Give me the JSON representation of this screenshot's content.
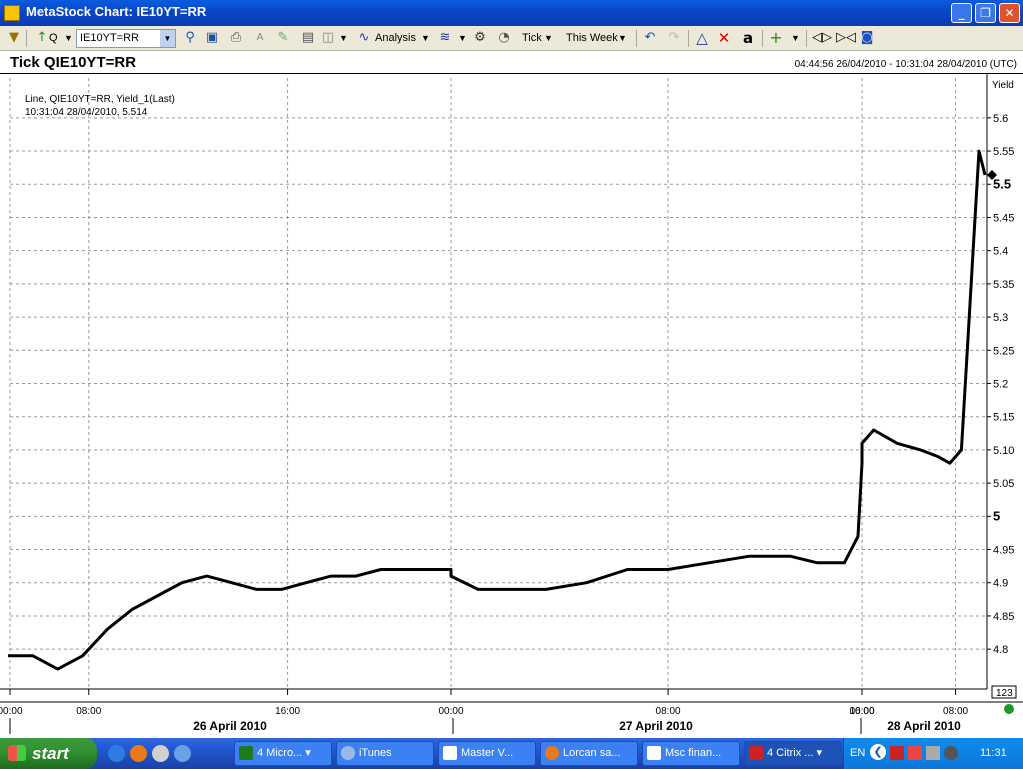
{
  "window": {
    "title": "MetaStock Chart: IE10YT=RR"
  },
  "toolbar": {
    "symbol_prefix": "Q",
    "symbol_value": "IE10YT=RR",
    "analysis_label": "Analysis",
    "periodicity_label": "Tick",
    "range_label": "This Week"
  },
  "chart_header": {
    "name": "Tick QIE10YT=RR",
    "time_range": "04:44:56 26/04/2010 - 10:31:04 28/04/2010 (UTC)"
  },
  "chart_data": {
    "type": "line",
    "legend_line1": "Line, QIE10YT=RR, Yield_1(Last)",
    "legend_line2": "10:31:04 28/04/2010, 5.514",
    "ylabel": "Yield",
    "ylim": [
      4.74,
      5.66
    ],
    "yticks": [
      "5.6",
      "5.55",
      "5.5",
      "5.45",
      "5.4",
      "5.35",
      "5.3",
      "5.25",
      "5.2",
      "5.15",
      "5.10",
      "5.05",
      "5",
      "4.95",
      "4.9",
      "4.85",
      "4.8"
    ],
    "bold_ticks": [
      "5.5",
      "5"
    ],
    "last_value": 5.514,
    "scale_box": "123",
    "time_ticks": [
      "00:00",
      "08:00",
      "16:00",
      "00:00",
      "08:00",
      "16:00",
      "00:00",
      "08:00"
    ],
    "day_labels": [
      "26 April 2010",
      "27 April 2010",
      "28 April 2010"
    ],
    "grid": true,
    "series": [
      {
        "x": [
          "26/04 04:45",
          "26/04 05:45",
          "26/04 06:45",
          "26/04 07:45",
          "26/04 08:45",
          "26/04 09:45",
          "26/04 10:45",
          "26/04 11:45",
          "26/04 12:45",
          "26/04 13:45",
          "26/04 14:45",
          "26/04 15:45",
          "26/04 16:45",
          "26/04 17:45",
          "26/04 18:45",
          "26/04 19:45",
          "26/04 21:00",
          "26/04 23:30",
          "27/04 01:00",
          "27/04 03:30",
          "27/04 05:00",
          "27/04 06:30",
          "27/04 08:00",
          "27/04 09:30",
          "27/04 11:00",
          "27/04 12:30",
          "27/04 13:30",
          "27/04 14:30",
          "27/04 15:00",
          "27/04 15:30",
          "27/04 16:30",
          "27/04 18:00",
          "27/04 19:30",
          "27/04 21:00",
          "27/04 22:30",
          "28/04 01:00",
          "28/04 03:00",
          "28/04 05:00",
          "28/04 06:30",
          "28/04 07:30",
          "28/04 08:00",
          "28/04 08:30",
          "28/04 09:00",
          "28/04 09:30",
          "28/04 10:00",
          "28/04 10:31"
        ],
        "y": [
          4.79,
          4.79,
          4.77,
          4.79,
          4.83,
          4.86,
          4.88,
          4.9,
          4.91,
          4.9,
          4.89,
          4.89,
          4.9,
          4.91,
          4.91,
          4.92,
          4.92,
          4.91,
          4.89,
          4.89,
          4.9,
          4.92,
          4.92,
          4.93,
          4.94,
          4.94,
          4.93,
          4.93,
          4.97,
          5.08,
          5.08,
          5.08,
          5.09,
          5.1,
          5.11,
          5.13,
          5.11,
          5.1,
          5.09,
          5.08,
          5.09,
          5.1,
          5.25,
          5.4,
          5.55,
          5.514
        ]
      }
    ]
  },
  "taskbar": {
    "start_label": "start",
    "tasks": [
      "4 Micro...",
      "iTunes",
      "Master V...",
      "Lorcan sa...",
      "Msc finan...",
      "4 Citrix ..."
    ],
    "lang": "EN",
    "clock": "11:31"
  }
}
